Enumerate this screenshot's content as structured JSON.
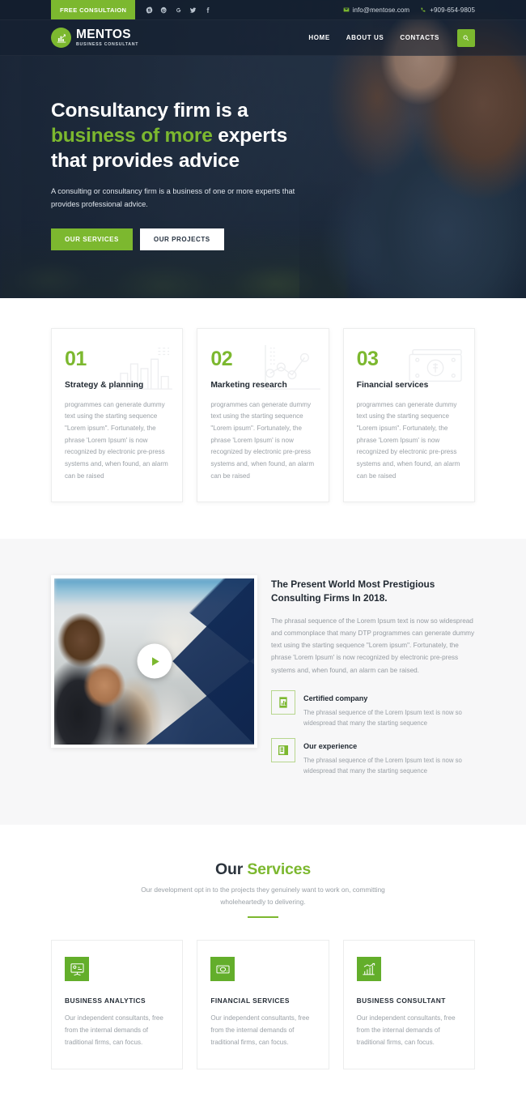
{
  "topbar": {
    "consult_label": "FREE CONSULTAION",
    "socials": [
      {
        "name": "skype-icon"
      },
      {
        "name": "pinterest-icon"
      },
      {
        "name": "google-plus-icon"
      },
      {
        "name": "twitter-icon"
      },
      {
        "name": "facebook-icon"
      }
    ],
    "email": "info@mentose.com",
    "phone": "+909-654-9805"
  },
  "brand": {
    "name": "MENTOS",
    "tagline": "BUSINESS CONSULTANT",
    "logo_icon": "chart-growth-icon"
  },
  "nav": {
    "items": [
      {
        "label": "HOME"
      },
      {
        "label": "ABOUT US"
      },
      {
        "label": "CONTACTS"
      }
    ],
    "search_icon": "search-icon"
  },
  "hero": {
    "title_line1": "Consultancy firm is a",
    "title_accent": "business of more",
    "title_line2_rest": " experts",
    "title_line3": "that provides advice",
    "subtitle": "A consulting or consultancy firm is a business of one or more experts that provides professional advice.",
    "primary_button": "OUR SERVICES",
    "secondary_button": "OUR PROJECTS"
  },
  "features": [
    {
      "number": "01",
      "title": "Strategy & planning",
      "text": "programmes can generate dummy text using the starting sequence \"Lorem ipsum\". Fortunately, the phrase 'Lorem Ipsum' is now recognized by electronic pre-press systems and, when found, an alarm can be raised",
      "watermark_icon": "bar-chart-icon"
    },
    {
      "number": "02",
      "title": "Marketing research",
      "text": "programmes can generate dummy text using the starting sequence \"Lorem ipsum\". Fortunately, the phrase 'Lorem Ipsum' is now recognized by electronic pre-press systems and, when found, an alarm can be raised",
      "watermark_icon": "node-graph-icon"
    },
    {
      "number": "03",
      "title": "Financial services",
      "text": "programmes can generate dummy text using the starting sequence \"Lorem ipsum\". Fortunately, the phrase 'Lorem Ipsum' is now recognized by electronic pre-press systems and, when found, an alarm can be raised",
      "watermark_icon": "banknote-icon"
    }
  ],
  "about": {
    "video_play_icon": "play-icon",
    "title": "The Present World Most Prestigious Consulting Firms In 2018.",
    "text": "The phrasal sequence of the Lorem Ipsum text is now so widespread and commonplace that many DTP programmes can generate dummy text using the starting sequence \"Lorem ipsum\". Fortunately, the phrase 'Lorem Ipsum' is now recognized by electronic pre-press systems and, when found, an alarm can be raised.",
    "items": [
      {
        "icon": "certificate-chart-icon",
        "title": "Certified company",
        "text": "The phrasal sequence of the Lorem Ipsum text is now so widespread that many the starting sequence"
      },
      {
        "icon": "document-list-icon",
        "title": "Our experience",
        "text": "The phrasal sequence of the Lorem Ipsum text is now so widespread that many the starting sequence"
      }
    ]
  },
  "services": {
    "title_plain": "Our ",
    "title_accent": "Services",
    "subtitle": "Our development opt in to the projects they genuinely want to work on, committing wholeheartedly to delivering.",
    "cards": [
      {
        "icon": "presentation-analytics-icon",
        "title": "BUSINESS ANALYTICS",
        "text": "Our independent consultants, free from the internal demands of traditional firms, can focus."
      },
      {
        "icon": "money-bill-icon",
        "title": "FINANCIAL SERVICES",
        "text": "Our independent consultants, free from the internal demands of traditional firms, can focus."
      },
      {
        "icon": "growth-bar-chart-icon",
        "title": "BUSINESS CONSULTANT",
        "text": "Our independent consultants, free from the internal demands of traditional firms, can focus."
      }
    ]
  },
  "colors": {
    "accent_green": "#7cb82f",
    "icon_green": "#63ae2b",
    "dark_navy": "#1d2e43",
    "heading": "#222a33",
    "body_text": "#9aa0a6",
    "section_bg": "#f7f7f8"
  }
}
